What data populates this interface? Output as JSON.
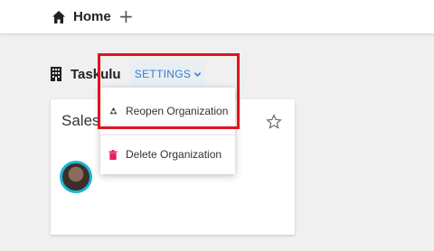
{
  "topbar": {
    "home_icon": "home-icon",
    "home_label": "Home",
    "add_icon": "plus-icon",
    "add_label": "+"
  },
  "organization": {
    "icon": "building-icon",
    "name": "Taskulu",
    "settings_label": "SETTINGS"
  },
  "settings_menu": {
    "items": [
      {
        "label": "Reopen Organization",
        "icon": "recycle-icon"
      },
      {
        "label": "Delete Organization",
        "icon": "trash-icon",
        "icon_color": "#e91e63"
      }
    ]
  },
  "board_card": {
    "title": "Sales",
    "star_icon": "star-icon"
  },
  "colors": {
    "accent": "#2a7fd4",
    "highlight": "#e0141e",
    "avatar_ring": "#19b7d6"
  }
}
